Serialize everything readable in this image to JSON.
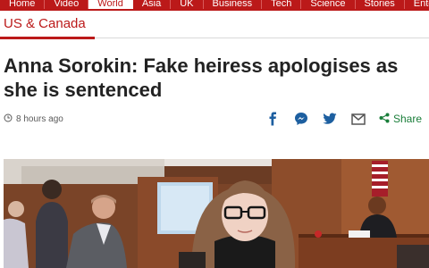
{
  "nav": {
    "items": [
      "Home",
      "Video",
      "World",
      "Asia",
      "UK",
      "Business",
      "Tech",
      "Science",
      "Stories",
      "Entertainment"
    ],
    "active_index": 2
  },
  "section": {
    "title": "US & Canada"
  },
  "article": {
    "headline": "Anna Sorokin: Fake heiress apologises as she is sentenced",
    "timestamp": "8 hours ago"
  },
  "share": {
    "label": "Share",
    "icons": [
      "facebook-icon",
      "messenger-icon",
      "twitter-icon",
      "email-icon",
      "share-icon"
    ]
  },
  "colors": {
    "brand": "#bb1919",
    "share": "#1a7e3a",
    "social": "#1d5fa0"
  }
}
